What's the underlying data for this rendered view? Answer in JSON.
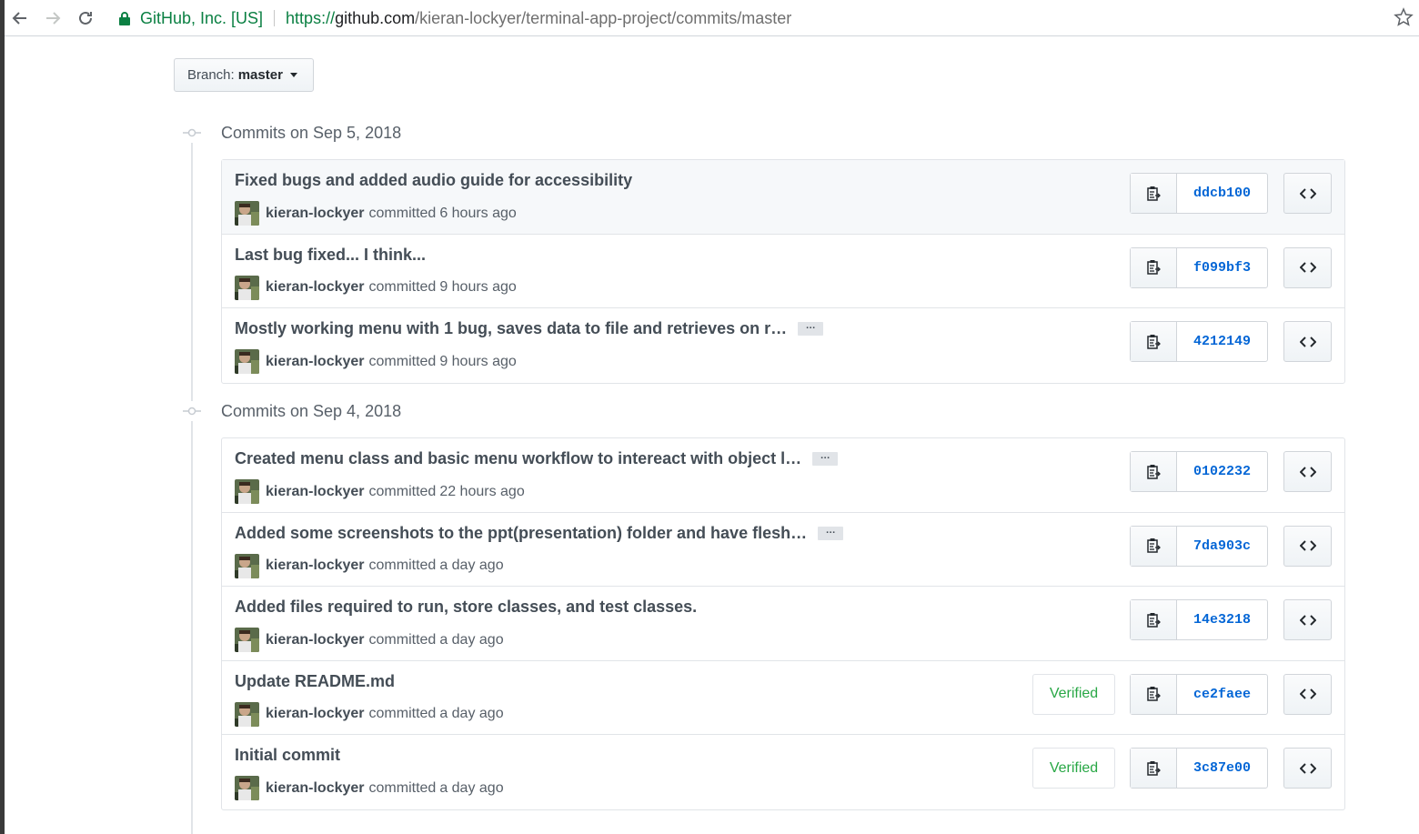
{
  "browser": {
    "site_identity": "GitHub, Inc. [US]",
    "url_scheme": "https://",
    "url_host": "github.com",
    "url_path": "/kieran-lockyer/terminal-app-project/commits/master"
  },
  "branch": {
    "label": "Branch:",
    "name": "master"
  },
  "icons": {
    "back": "arrow-left-icon",
    "forward": "arrow-right-icon",
    "reload": "reload-icon",
    "lock": "lock-icon",
    "star": "star-icon",
    "commit": "git-commit-icon",
    "copy": "clippy-icon",
    "browse": "code-icon"
  },
  "colors": {
    "link": "#0366d6",
    "verified": "#28a745",
    "secure": "#0b8043"
  },
  "groups": [
    {
      "title": "Commits on Sep 5, 2018",
      "commits": [
        {
          "message": "Fixed bugs and added audio guide for accessibility",
          "truncated": false,
          "author": "kieran-lockyer",
          "action": "committed",
          "time": "6 hours ago",
          "verified": "",
          "sha": "ddcb100"
        },
        {
          "message": "Last bug fixed... I think...",
          "truncated": false,
          "author": "kieran-lockyer",
          "action": "committed",
          "time": "9 hours ago",
          "verified": "",
          "sha": "f099bf3"
        },
        {
          "message": "Mostly working menu with 1 bug, saves data to file and retrieves on r…",
          "truncated": true,
          "author": "kieran-lockyer",
          "action": "committed",
          "time": "9 hours ago",
          "verified": "",
          "sha": "4212149"
        }
      ]
    },
    {
      "title": "Commits on Sep 4, 2018",
      "commits": [
        {
          "message": "Created menu class and basic menu workflow to intereact with object l…",
          "truncated": true,
          "author": "kieran-lockyer",
          "action": "committed",
          "time": "22 hours ago",
          "verified": "",
          "sha": "0102232"
        },
        {
          "message": "Added some screenshots to the ppt(presentation) folder and have flesh…",
          "truncated": true,
          "author": "kieran-lockyer",
          "action": "committed",
          "time": "a day ago",
          "verified": "",
          "sha": "7da903c"
        },
        {
          "message": "Added files required to run, store classes, and test classes.",
          "truncated": false,
          "author": "kieran-lockyer",
          "action": "committed",
          "time": "a day ago",
          "verified": "",
          "sha": "14e3218"
        },
        {
          "message": "Update README.md",
          "truncated": false,
          "author": "kieran-lockyer",
          "action": "committed",
          "time": "a day ago",
          "verified": "Verified",
          "sha": "ce2faee"
        },
        {
          "message": "Initial commit",
          "truncated": false,
          "author": "kieran-lockyer",
          "action": "committed",
          "time": "a day ago",
          "verified": "Verified",
          "sha": "3c87e00"
        }
      ]
    }
  ],
  "ellipsis_label": "…"
}
